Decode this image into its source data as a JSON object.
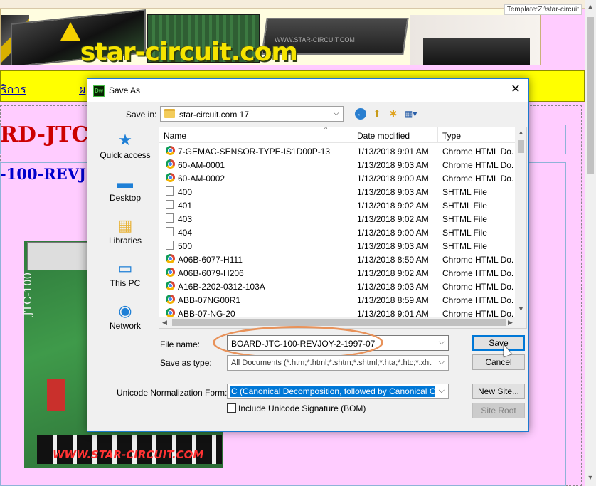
{
  "webpage": {
    "template_label": "Template:Z:\\star-circuit",
    "banner_title": "star-circuit.com",
    "banner_watermark": "WWW.STAR-CIRCUIT.COM",
    "nav_link_1": "ริการ",
    "nav_link_2": "ผ",
    "heading_1": "RD-JTC-",
    "heading_2": "-100-REVJ",
    "board_watermark": "WWW.STAR-CIRCUIT.COM",
    "board_model": "JTC-100"
  },
  "dialog": {
    "app_icon": "Dw",
    "title": "Save As",
    "close_glyph": "✕",
    "save_in_label": "Save in:",
    "save_in_value": "star-circuit.com 17",
    "places": [
      {
        "label": "Quick access",
        "icon": "★"
      },
      {
        "label": "Desktop",
        "icon": "▬"
      },
      {
        "label": "Libraries",
        "icon": "▦"
      },
      {
        "label": "This PC",
        "icon": "▭"
      },
      {
        "label": "Network",
        "icon": "◉"
      }
    ],
    "columns": {
      "name": "Name",
      "date": "Date modified",
      "type": "Type"
    },
    "files": [
      {
        "name": "7-GEMAC-SENSOR-TYPE-IS1D00P-13",
        "date": "1/13/2018 9:01 AM",
        "type": "Chrome HTML Do...",
        "icon": "chrome"
      },
      {
        "name": "60-AM-0001",
        "date": "1/13/2018 9:03 AM",
        "type": "Chrome HTML Do...",
        "icon": "chrome"
      },
      {
        "name": "60-AM-0002",
        "date": "1/13/2018 9:00 AM",
        "type": "Chrome HTML Do...",
        "icon": "chrome"
      },
      {
        "name": "400",
        "date": "1/13/2018 9:03 AM",
        "type": "SHTML File",
        "icon": "page"
      },
      {
        "name": "401",
        "date": "1/13/2018 9:02 AM",
        "type": "SHTML File",
        "icon": "page"
      },
      {
        "name": "403",
        "date": "1/13/2018 9:02 AM",
        "type": "SHTML File",
        "icon": "page"
      },
      {
        "name": "404",
        "date": "1/13/2018 9:00 AM",
        "type": "SHTML File",
        "icon": "page"
      },
      {
        "name": "500",
        "date": "1/13/2018 9:03 AM",
        "type": "SHTML File",
        "icon": "page"
      },
      {
        "name": "A06B-6077-H111",
        "date": "1/13/2018 8:59 AM",
        "type": "Chrome HTML Do...",
        "icon": "chrome"
      },
      {
        "name": "A06B-6079-H206",
        "date": "1/13/2018 9:02 AM",
        "type": "Chrome HTML Do...",
        "icon": "chrome"
      },
      {
        "name": "A16B-2202-0312-103A",
        "date": "1/13/2018 9:03 AM",
        "type": "Chrome HTML Do...",
        "icon": "chrome"
      },
      {
        "name": "ABB-07NG00R1",
        "date": "1/13/2018 8:59 AM",
        "type": "Chrome HTML Do...",
        "icon": "chrome"
      },
      {
        "name": "ABB-07-NG-20",
        "date": "1/13/2018 9:01 AM",
        "type": "Chrome HTML Do...",
        "icon": "chrome"
      }
    ],
    "file_name_label": "File name:",
    "file_name_value": "BOARD-JTC-100-REVJOY-2-1997-07",
    "save_as_type_label": "Save as type:",
    "save_as_type_value": "All Documents (*.htm;*.html;*.shtm;*.shtml;*.hta;*.htc;*.xhtml;*.s",
    "unicode_label": "Unicode Normalization Form:",
    "unicode_value": "C (Canonical Decomposition, followed by Canonical Composi",
    "bom_label": "Include Unicode Signature (BOM)",
    "bom_checked": false,
    "buttons": {
      "save": "Save",
      "cancel": "Cancel",
      "new_site": "New Site...",
      "site_root": "Site Root"
    }
  },
  "colors": {
    "page_bg": "#ffccff",
    "nav_bg": "#ffff00",
    "accent": "#0078d7",
    "highlight_oval": "#e8925a"
  }
}
